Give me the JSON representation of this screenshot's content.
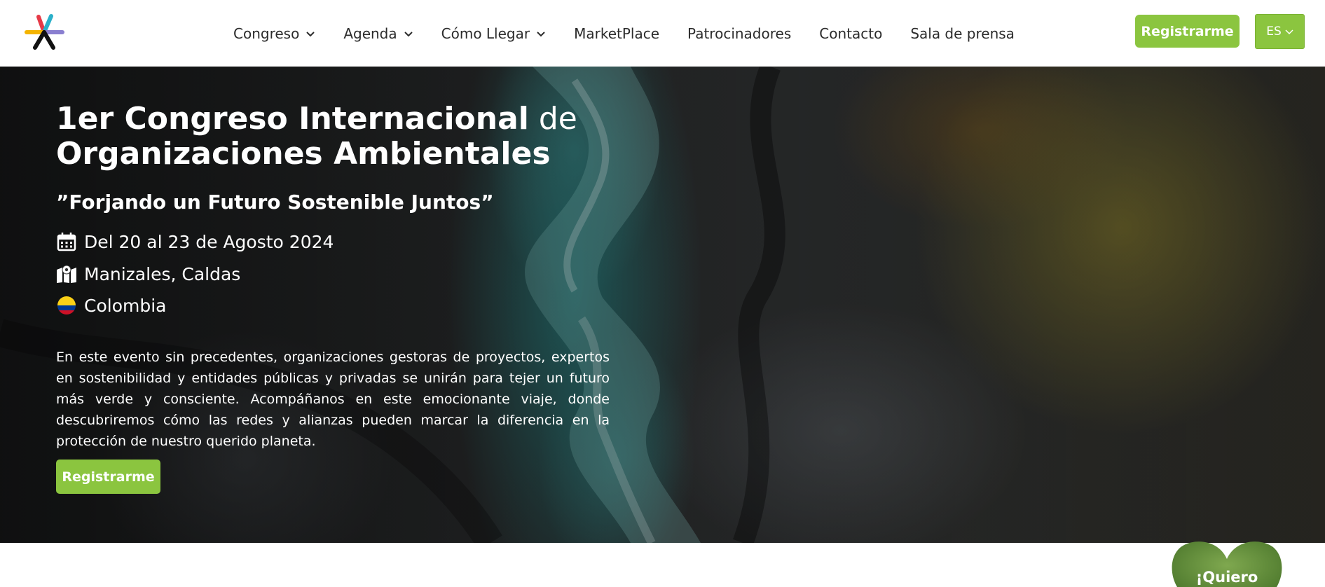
{
  "header": {
    "logo_name": "congress-logo",
    "nav": [
      {
        "label": "Congreso",
        "dropdown": true
      },
      {
        "label": "Agenda",
        "dropdown": true
      },
      {
        "label": "Cómo Llegar",
        "dropdown": true
      },
      {
        "label": "MarketPlace",
        "dropdown": false
      },
      {
        "label": "Patrocinadores",
        "dropdown": false
      },
      {
        "label": "Contacto",
        "dropdown": false
      },
      {
        "label": "Sala de prensa",
        "dropdown": false
      }
    ],
    "register_label": "Registrarme",
    "language": "ES"
  },
  "hero": {
    "title_bold_1": "1er Congreso Internacional",
    "title_light": " de",
    "title_bold_2": "Organizaciones Ambientales",
    "subtitle": "”Forjando un Futuro Sostenible Juntos”",
    "date": "Del 20 al 23 de Agosto 2024",
    "city": "Manizales, Caldas",
    "country": "Colombia",
    "description": "En este evento sin precedentes, organizaciones gestoras de proyectos, expertos en sostenibilidad y entidades públicas y privadas se unirán para tejer un futuro más verde y consciente. Acompáñanos en este emocionante viaje, donde descubriremos cómo las redes y alianzas pueden marcar la diferencia en la protección de nuestro querido planeta.",
    "register_label": "Registrarme"
  },
  "floating": {
    "heart_label": "¡Quiero"
  },
  "colors": {
    "accent": "#8bc53f",
    "text_dark": "#2b2b2b",
    "white": "#ffffff"
  }
}
